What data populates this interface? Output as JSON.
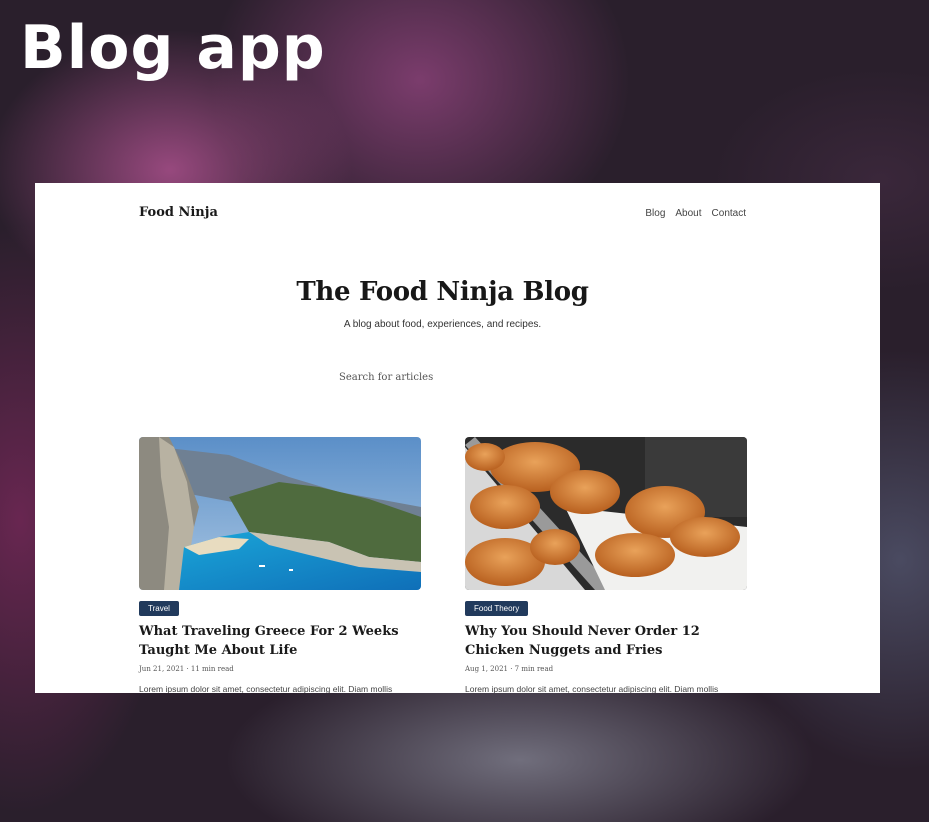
{
  "overlay": {
    "title": "Blog app"
  },
  "nav": {
    "brand": "Food Ninja",
    "links": [
      "Blog",
      "About",
      "Contact"
    ]
  },
  "hero": {
    "title": "The Food Ninja Blog",
    "subtitle": "A blog about food, experiences, and recipes."
  },
  "search": {
    "placeholder": "Search for articles"
  },
  "posts": [
    {
      "tag": "Travel",
      "title": "What Traveling Greece For 2 Weeks Taught Me About Life",
      "meta": "Jun 21, 2021 · 11 min read",
      "excerpt": "Lorem ipsum dolor sit amet, consectetur adipiscing elit. Diam mollis"
    },
    {
      "tag": "Food Theory",
      "title": "Why You Should Never Order 12 Chicken Nuggets and Fries",
      "meta": "Aug 1, 2021 · 7 min read",
      "excerpt": "Lorem ipsum dolor sit amet, consectetur adipiscing elit. Diam mollis"
    }
  ],
  "colors": {
    "tag_background": "#213a5c",
    "page_background": "#ffffff"
  }
}
